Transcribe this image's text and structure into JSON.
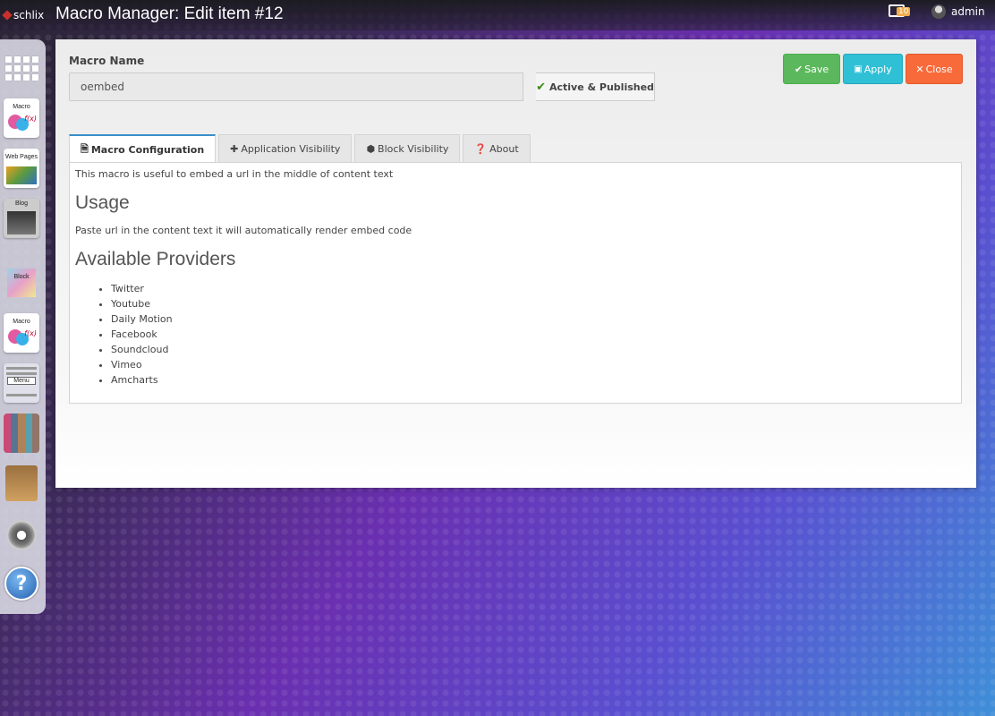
{
  "topbar": {
    "brand": "schlix",
    "title": "Macro Manager: Edit item #12",
    "notification_count": "10",
    "username": "admin"
  },
  "dock": {
    "items": [
      {
        "name": "all-apps",
        "label": ""
      },
      {
        "name": "macro",
        "label": "Macro"
      },
      {
        "name": "web-pages",
        "label": "Web Pages"
      },
      {
        "name": "blog",
        "label": "Blog"
      },
      {
        "name": "block",
        "label": "Block"
      },
      {
        "name": "macro-manager",
        "label": "Macro"
      },
      {
        "name": "menu",
        "label": "Menu"
      },
      {
        "name": "users",
        "label": ""
      },
      {
        "name": "tools",
        "label": ""
      },
      {
        "name": "settings",
        "label": ""
      },
      {
        "name": "help",
        "label": "?"
      }
    ]
  },
  "form": {
    "macro_name_label": "Macro Name",
    "macro_name_value": "oembed",
    "status_label": "Active & Published"
  },
  "buttons": {
    "save": "Save",
    "apply": "Apply",
    "close": "Close"
  },
  "tabs": [
    {
      "label": "Macro Configuration",
      "active": true
    },
    {
      "label": "Application Visibility",
      "active": false
    },
    {
      "label": "Block Visibility",
      "active": false
    },
    {
      "label": "About",
      "active": false
    }
  ],
  "content": {
    "intro": "This macro is useful to embed a url in the middle of content text",
    "usage_heading": "Usage",
    "usage_text": "Paste url in the content text it will automatically render embed code",
    "providers_heading": "Available Providers",
    "providers": [
      "Twitter",
      "Youtube",
      "Daily Motion",
      "Facebook",
      "Soundcloud",
      "Vimeo",
      "Amcharts"
    ]
  },
  "colors": {
    "save": "#5cb85c",
    "apply": "#2fc0d6",
    "close": "#f86a3a",
    "active_tab_accent": "#3a8ec8"
  }
}
